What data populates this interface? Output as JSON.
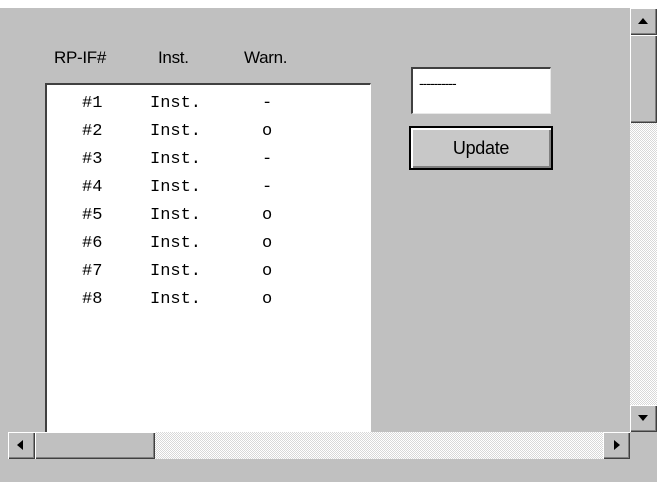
{
  "list": {
    "headers": {
      "id": "RP-IF#",
      "inst": "Inst.",
      "warn": "Warn."
    },
    "rows": [
      {
        "id": "#1",
        "inst": "Inst.",
        "warn": "-"
      },
      {
        "id": "#2",
        "inst": "Inst.",
        "warn": "o"
      },
      {
        "id": "#3",
        "inst": "Inst.",
        "warn": "-"
      },
      {
        "id": "#4",
        "inst": "Inst.",
        "warn": "-"
      },
      {
        "id": "#5",
        "inst": "Inst.",
        "warn": "o"
      },
      {
        "id": "#6",
        "inst": "Inst.",
        "warn": "o"
      },
      {
        "id": "#7",
        "inst": "Inst.",
        "warn": "o"
      },
      {
        "id": "#8",
        "inst": "Inst.",
        "warn": "o"
      }
    ]
  },
  "status_field": {
    "value": "----------"
  },
  "update_button": {
    "label": "Update"
  },
  "icons": {
    "scroll_up": "arrow-up-icon",
    "scroll_down": "arrow-down-icon",
    "scroll_left": "arrow-left-icon",
    "scroll_right": "arrow-right-icon"
  },
  "colors": {
    "window_bg": "#c0c0c0",
    "list_bg": "#ffffff",
    "text": "#000000"
  }
}
